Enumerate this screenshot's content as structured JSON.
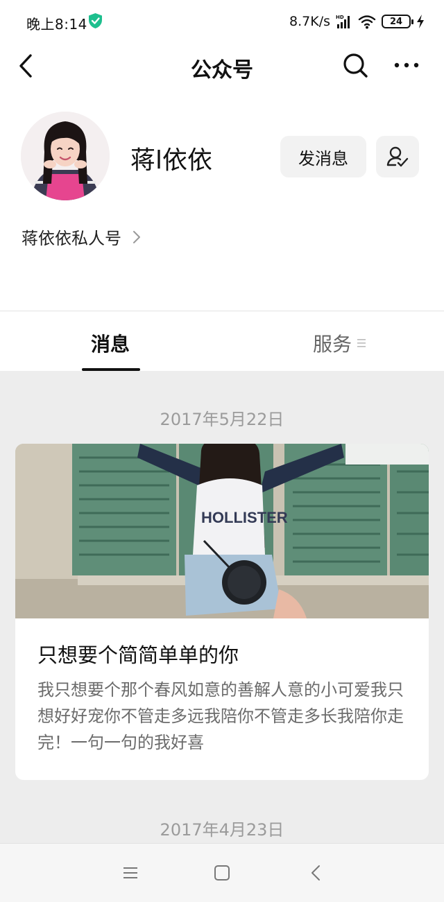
{
  "status_bar": {
    "time": "晚上8:14",
    "net_speed": "8.7K/s",
    "battery": "24",
    "icons": [
      "security-shield-icon",
      "hd-signal-icon",
      "wifi-icon",
      "battery-icon",
      "charging-icon"
    ]
  },
  "nav": {
    "title": "公众号",
    "icons": [
      "back-icon",
      "search-icon",
      "more-icon"
    ]
  },
  "profile": {
    "name": "蒋l依依",
    "send_message_label": "发消息",
    "follow_icon": "followed-user-check-icon",
    "description": "蒋依依私人号"
  },
  "tabs": {
    "messages": "消息",
    "services": "服务",
    "active": "消息"
  },
  "feed": {
    "dates": [
      "2017年5月22日",
      "2017年4月23日"
    ],
    "article": {
      "title": "只想要个简简单单的你",
      "body": "我只想要个那个春风如意的善解人意的小可爱我只想好好宠你不管走多远我陪你不管走多长我陪你走完！一句一句的我好喜"
    }
  },
  "system_nav": {
    "icons": [
      "menu-icon",
      "home-icon",
      "back-icon"
    ]
  },
  "colors": {
    "feed_background": "#ededed",
    "tab_active": "#111111",
    "date_text": "#9b9b9b",
    "body_text": "#6b6b6b"
  }
}
